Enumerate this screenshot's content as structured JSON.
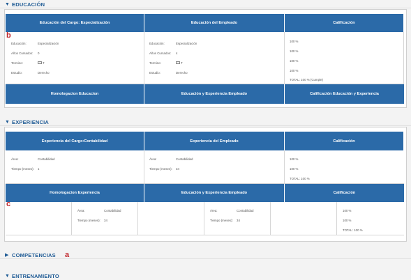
{
  "sections": {
    "educacion": {
      "title": "EDUCACIÓN",
      "arrow": "▼"
    },
    "experiencia": {
      "title": "EXPERIENCIA",
      "arrow": "▼"
    },
    "competencias": {
      "title": "COMPETENCIAS",
      "arrow": "▶"
    },
    "entrenamiento": {
      "title": "ENTRENAMIENTO",
      "arrow": "▼"
    }
  },
  "educacion_table": {
    "headers": [
      "Educación del Cargo: Especialización",
      "Educación del Empleado",
      "Calificación"
    ],
    "cargo": [
      {
        "label": "Educación:",
        "value": "Especialización"
      },
      {
        "label": "Años Cursados:",
        "value": "0"
      },
      {
        "label": "Termino:",
        "value": "T"
      },
      {
        "label": "Estudio:",
        "value": "Derecho"
      }
    ],
    "empleado": [
      {
        "label": "Educación:",
        "value": "Especialización"
      },
      {
        "label": "Años Cursados:",
        "value": "4"
      },
      {
        "label": "Termino:",
        "value": "T"
      },
      {
        "label": "Estudio:",
        "value": "Derecho"
      }
    ],
    "calificacion": [
      "100 %",
      "100 %",
      "100 %",
      "100 %",
      "TOTAL: 100 % (Cumple)"
    ],
    "footer_headers": [
      "Homologacion Educacion",
      "Educación y Experiencia Empleado",
      "Calificación Educación y Experiencia"
    ]
  },
  "experiencia_table": {
    "headers": [
      "Experiencia del Cargo:Contabilidad",
      "Experiencia del Empleado",
      "Calificación"
    ],
    "cargo": [
      {
        "label": "Área:",
        "value": "Contabilidad"
      },
      {
        "label": "Tiempo (meses):",
        "value": "1"
      }
    ],
    "empleado": [
      {
        "label": "Área:",
        "value": "Contabilidad"
      },
      {
        "label": "Tiempo (meses):",
        "value": "34"
      }
    ],
    "calificacion": [
      "100 %",
      "100 %",
      "TOTAL: 100 %"
    ]
  },
  "homologacion_table": {
    "headers": [
      "Homologacion Experiencia",
      "Educación y Experiencia Empleado",
      "Calificación"
    ],
    "left": [
      {
        "label": "Área:",
        "value": "Contabilidad"
      },
      {
        "label": "Tiempo (meses):",
        "value": "34"
      }
    ],
    "middle": [
      {
        "label": "Área:",
        "value": "Contabilidad"
      },
      {
        "label": "Tiempo (meses):",
        "value": "34"
      }
    ],
    "calificacion": [
      "100 %",
      "100 %",
      "TOTAL: 100 %"
    ]
  },
  "annotations": {
    "a": "a",
    "b": "b",
    "c": "c"
  },
  "colors": {
    "header_blue": "#2b6aa8",
    "section_title": "#1f5b95",
    "annotation_red": "#c0272d"
  }
}
